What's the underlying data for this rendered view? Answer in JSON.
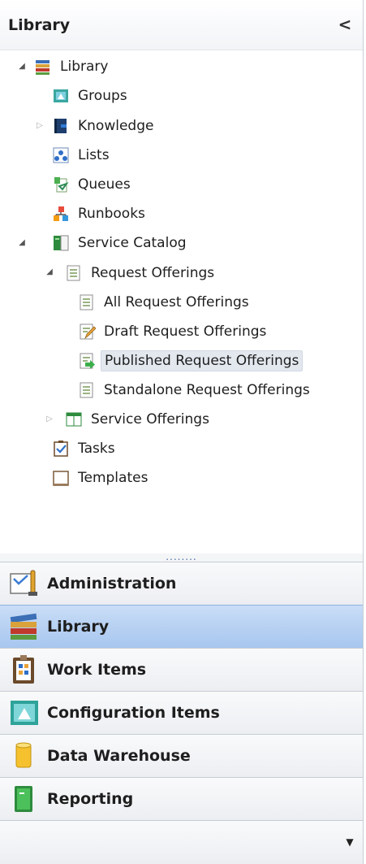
{
  "panel": {
    "title": "Library",
    "collapse_glyph": "<"
  },
  "tree": {
    "items": [
      {
        "label": "Library",
        "icon": "books-icon"
      },
      {
        "label": "Groups",
        "icon": "groups-icon"
      },
      {
        "label": "Knowledge",
        "icon": "knowledge-book-icon"
      },
      {
        "label": "Lists",
        "icon": "lists-icon"
      },
      {
        "label": "Queues",
        "icon": "queues-icon"
      },
      {
        "label": "Runbooks",
        "icon": "runbooks-icon"
      },
      {
        "label": "Service Catalog",
        "icon": "service-catalog-icon"
      },
      {
        "label": "Request Offerings",
        "icon": "document-icon"
      },
      {
        "label": "All Request Offerings",
        "icon": "document-icon"
      },
      {
        "label": "Draft Request Offerings",
        "icon": "draft-document-icon"
      },
      {
        "label": "Published Request Offerings",
        "icon": "published-document-icon"
      },
      {
        "label": "Standalone Request Offerings",
        "icon": "document-icon"
      },
      {
        "label": "Service Offerings",
        "icon": "service-offerings-icon"
      },
      {
        "label": "Tasks",
        "icon": "tasks-icon"
      },
      {
        "label": "Templates",
        "icon": "templates-icon"
      }
    ],
    "selected": "Published Request Offerings"
  },
  "splitter": {
    "grip": "........"
  },
  "wunderbar": {
    "buttons": [
      {
        "label": "Administration",
        "icon": "administration-icon"
      },
      {
        "label": "Library",
        "icon": "library-icon"
      },
      {
        "label": "Work Items",
        "icon": "work-items-icon"
      },
      {
        "label": "Configuration Items",
        "icon": "configuration-items-icon"
      },
      {
        "label": "Data Warehouse",
        "icon": "data-warehouse-icon"
      },
      {
        "label": "Reporting",
        "icon": "reporting-icon"
      }
    ],
    "active": "Library"
  },
  "bottom_bar": {
    "overflow_glyph": "▼"
  },
  "colors": {
    "active_button": "#a7c6ef",
    "selection": "#e3e8ef"
  }
}
